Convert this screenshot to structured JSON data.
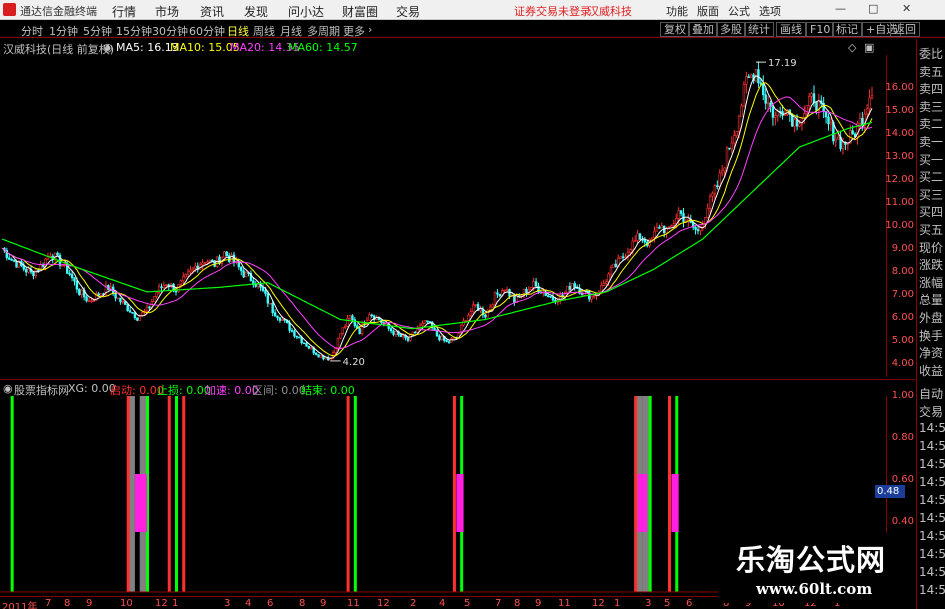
{
  "titlebar": {
    "app_name": "通达信金融终端",
    "menus": [
      "行情",
      "市场",
      "资讯",
      "发现",
      "问小达",
      "财富圈",
      "交易"
    ],
    "login_status": "证券交易未登录",
    "stock_name": "汉威科技",
    "right_menus": [
      "功能",
      "版面",
      "公式",
      "选项"
    ],
    "window_buttons": [
      "—",
      "□",
      "✕"
    ]
  },
  "toolbar": {
    "periods": [
      "分时",
      "1分钟",
      "5分钟",
      "15分钟",
      "30分钟",
      "60分钟",
      "日线",
      "周线",
      "月线",
      "多周期",
      "更多"
    ],
    "active_period": "日线",
    "tools": [
      "复权",
      "叠加",
      "多股",
      "统计",
      "画线",
      "F10",
      "标记",
      "+自选",
      "返回"
    ]
  },
  "price_panel": {
    "title": "汉威科技(日线 前复权)",
    "ma5_label": "MA5: 16.13",
    "ma10_label": "MA10: 15.05",
    "ma20_label": "MA20: 14.35",
    "ma60_label": "MA60: 14.57",
    "colors": {
      "up": "#ff3030",
      "down": "#40ffff",
      "ma5": "#ffffff",
      "ma10": "#ffff00",
      "ma20": "#ff40ff",
      "ma60": "#00ff00"
    },
    "high_annotation": "17.19",
    "low_annotation": "4.20",
    "y_ticks": [
      "16.00",
      "15.00",
      "14.00",
      "13.00",
      "12.00",
      "11.00",
      "10.00",
      "9.00",
      "8.00",
      "7.00",
      "6.00",
      "5.00",
      "4.00"
    ]
  },
  "indicator_panel": {
    "name": "股票指标网",
    "xg": "XG: 0.00",
    "qidong": "启动: 0.00",
    "zhisun": "止损: 0.00",
    "jiasu": "加速: 0.00",
    "qujian": "区间: 0.00",
    "jieshu": "结束: 0.00",
    "y_ticks": [
      "1.00",
      "0.80",
      "0.60",
      "0.40"
    ],
    "current_value": "0.48"
  },
  "date_axis": [
    "2011年",
    "7",
    "8",
    "9",
    "10",
    "12",
    "1",
    "3",
    "4",
    "6",
    "8",
    "9",
    "11",
    "12",
    "2",
    "4",
    "5",
    "7",
    "8",
    "9",
    "11",
    "12",
    "1",
    "3",
    "5",
    "6",
    "8",
    "9",
    "10",
    "12",
    "1"
  ],
  "right_panel": {
    "quote_labels": [
      "委比",
      "卖五",
      "卖四",
      "卖三",
      "卖二",
      "卖一",
      "买一",
      "买二",
      "买三",
      "买四",
      "买五",
      "现价",
      "涨跌",
      "涨幅",
      "总量",
      "外盘",
      "换手",
      "净资",
      "收益"
    ],
    "trade_labels": [
      "自动",
      "交易",
      "14:5",
      "14:5",
      "14:5",
      "14:5",
      "14:5",
      "14:5",
      "14:5",
      "14:5",
      "14:5",
      "14:5"
    ]
  },
  "watermark": {
    "title": "乐淘公式网",
    "url": "www.60lt.com"
  },
  "chart_data": {
    "type": "candlestick",
    "title": "汉威科技(日线 前复权)",
    "ylim": [
      3.5,
      17.5
    ],
    "close_path": [
      [
        0,
        9.1
      ],
      [
        4,
        8.6
      ],
      [
        8,
        8.3
      ],
      [
        12,
        8.0
      ],
      [
        16,
        8.3
      ],
      [
        20,
        8.9
      ],
      [
        24,
        8.5
      ],
      [
        28,
        8.0
      ],
      [
        32,
        7.2
      ],
      [
        36,
        6.8
      ],
      [
        40,
        7.1
      ],
      [
        44,
        7.4
      ],
      [
        48,
        6.9
      ],
      [
        52,
        6.5
      ],
      [
        56,
        6.1
      ],
      [
        60,
        6.4
      ],
      [
        64,
        7.2
      ],
      [
        68,
        7.6
      ],
      [
        72,
        7.3
      ],
      [
        76,
        7.8
      ],
      [
        80,
        8.3
      ],
      [
        84,
        8.6
      ],
      [
        88,
        8.4
      ],
      [
        92,
        8.9
      ],
      [
        96,
        8.5
      ],
      [
        100,
        8.0
      ],
      [
        104,
        7.7
      ],
      [
        108,
        7.2
      ],
      [
        112,
        6.4
      ],
      [
        116,
        6.0
      ],
      [
        120,
        5.5
      ],
      [
        124,
        5.1
      ],
      [
        128,
        4.7
      ],
      [
        132,
        4.4
      ],
      [
        136,
        4.3
      ],
      [
        140,
        5.4
      ],
      [
        144,
        6.1
      ],
      [
        148,
        5.5
      ],
      [
        152,
        6.3
      ],
      [
        156,
        6.0
      ],
      [
        160,
        5.6
      ],
      [
        164,
        5.3
      ],
      [
        168,
        5.1
      ],
      [
        172,
        5.6
      ],
      [
        176,
        5.9
      ],
      [
        180,
        5.3
      ],
      [
        184,
        5.0
      ],
      [
        188,
        5.2
      ],
      [
        192,
        6.1
      ],
      [
        196,
        6.6
      ],
      [
        200,
        6.2
      ],
      [
        204,
        7.0
      ],
      [
        208,
        7.4
      ],
      [
        212,
        6.8
      ],
      [
        216,
        7.2
      ],
      [
        220,
        7.5
      ],
      [
        224,
        7.2
      ],
      [
        228,
        6.9
      ],
      [
        232,
        7.0
      ],
      [
        236,
        7.6
      ],
      [
        240,
        7.2
      ],
      [
        244,
        7.0
      ],
      [
        248,
        7.4
      ],
      [
        252,
        8.1
      ],
      [
        256,
        8.6
      ],
      [
        260,
        9.2
      ],
      [
        264,
        9.6
      ],
      [
        268,
        9.3
      ],
      [
        272,
        10.1
      ],
      [
        276,
        9.8
      ],
      [
        280,
        10.7
      ],
      [
        284,
        10.2
      ],
      [
        288,
        9.8
      ],
      [
        292,
        10.9
      ],
      [
        296,
        11.8
      ],
      [
        300,
        13.2
      ],
      [
        304,
        14.5
      ],
      [
        308,
        16.3
      ],
      [
        312,
        16.9
      ],
      [
        316,
        15.6
      ],
      [
        320,
        14.8
      ],
      [
        324,
        15.3
      ],
      [
        328,
        14.6
      ],
      [
        332,
        15.0
      ],
      [
        336,
        15.7
      ],
      [
        340,
        14.8
      ],
      [
        344,
        14.1
      ],
      [
        348,
        13.6
      ],
      [
        352,
        14.0
      ],
      [
        356,
        14.8
      ],
      [
        360,
        16.1
      ]
    ],
    "ma60_path": [
      [
        0,
        9.5
      ],
      [
        30,
        8.3
      ],
      [
        60,
        7.2
      ],
      [
        90,
        7.4
      ],
      [
        110,
        7.6
      ],
      [
        140,
        6.0
      ],
      [
        170,
        5.6
      ],
      [
        200,
        6.0
      ],
      [
        230,
        6.8
      ],
      [
        250,
        7.2
      ],
      [
        270,
        8.2
      ],
      [
        290,
        9.5
      ],
      [
        310,
        11.5
      ],
      [
        330,
        13.5
      ],
      [
        350,
        14.3
      ],
      [
        360,
        14.57
      ]
    ],
    "indicator_bars": [
      {
        "x": 4,
        "type": "green"
      },
      {
        "x": 52,
        "type": "red_gray"
      },
      {
        "x": 57,
        "type": "gray"
      },
      {
        "x": 60,
        "type": "green"
      },
      {
        "x": 69,
        "type": "red"
      },
      {
        "x": 72,
        "type": "green"
      },
      {
        "x": 75,
        "type": "red"
      },
      {
        "x": 143,
        "type": "red"
      },
      {
        "x": 146,
        "type": "green"
      },
      {
        "x": 187,
        "type": "red"
      },
      {
        "x": 190,
        "type": "green"
      },
      {
        "x": 262,
        "type": "red_gray"
      },
      {
        "x": 265,
        "type": "gray"
      },
      {
        "x": 268,
        "type": "green"
      },
      {
        "x": 276,
        "type": "red"
      },
      {
        "x": 279,
        "type": "green"
      }
    ],
    "magenta_blocks": [
      {
        "x": 55,
        "w": 5
      },
      {
        "x": 188,
        "w": 3
      },
      {
        "x": 263,
        "w": 4
      },
      {
        "x": 277,
        "w": 3
      }
    ]
  }
}
